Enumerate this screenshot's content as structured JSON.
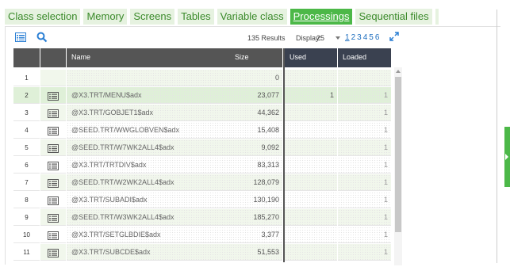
{
  "tabs": [
    {
      "label": "Class selection",
      "active": false
    },
    {
      "label": "Memory",
      "active": false
    },
    {
      "label": "Screens",
      "active": false
    },
    {
      "label": "Tables",
      "active": false
    },
    {
      "label": "Variable class",
      "active": false
    },
    {
      "label": "Processings",
      "active": true
    },
    {
      "label": "Sequential files",
      "active": false
    }
  ],
  "toolbar": {
    "list_icon": "list-view-icon",
    "search_icon": "search-icon",
    "results": "135 Results",
    "display_label": "Display:",
    "display_value": "25",
    "pages": [
      "1",
      "2",
      "3",
      "4",
      "5",
      "6"
    ],
    "current_page": "1",
    "expand_icon": "expand-icon"
  },
  "columns": {
    "name": "Name",
    "size": "Size",
    "used": "Used",
    "loaded": "Loaded"
  },
  "rows": [
    {
      "num": "1",
      "name": "",
      "size": "0",
      "used": "",
      "loaded": ""
    },
    {
      "num": "2",
      "name": "@X3.TRT/MENU$adx",
      "size": "23,077",
      "used": "1",
      "loaded": "1"
    },
    {
      "num": "3",
      "name": "@X3.TRT/GOBJET1$adx",
      "size": "44,362",
      "used": "",
      "loaded": "1"
    },
    {
      "num": "4",
      "name": "@SEED.TRT/WWGLOBVEN$adx",
      "size": "15,408",
      "used": "",
      "loaded": "1"
    },
    {
      "num": "5",
      "name": "@SEED.TRT/W7WK2ALL4$adx",
      "size": "9,092",
      "used": "",
      "loaded": "1"
    },
    {
      "num": "6",
      "name": "@X3.TRT/TRTDIV$adx",
      "size": "83,313",
      "used": "",
      "loaded": "1"
    },
    {
      "num": "7",
      "name": "@SEED.TRT/W2WK2ALL4$adx",
      "size": "128,079",
      "used": "",
      "loaded": "1"
    },
    {
      "num": "8",
      "name": "@X3.TRT/SUBADI$adx",
      "size": "130,190",
      "used": "",
      "loaded": "1"
    },
    {
      "num": "9",
      "name": "@SEED.TRT/W3WK2ALL4$adx",
      "size": "185,270",
      "used": "",
      "loaded": "1"
    },
    {
      "num": "10",
      "name": "@X3.TRT/SETGLBDIE$adx",
      "size": "3,377",
      "used": "",
      "loaded": "1"
    },
    {
      "num": "11",
      "name": "@X3.TRT/SUBCDE$adx",
      "size": "51,553",
      "used": "",
      "loaded": "1"
    }
  ],
  "selected_row": "2",
  "colors": {
    "accent": "#4cb848",
    "tab_bg": "#e6f2e0",
    "header_bg": "#555555",
    "header_dark": "#3a4150",
    "row_selected": "#dff0d8",
    "row_alt": "#f1f7ec"
  }
}
